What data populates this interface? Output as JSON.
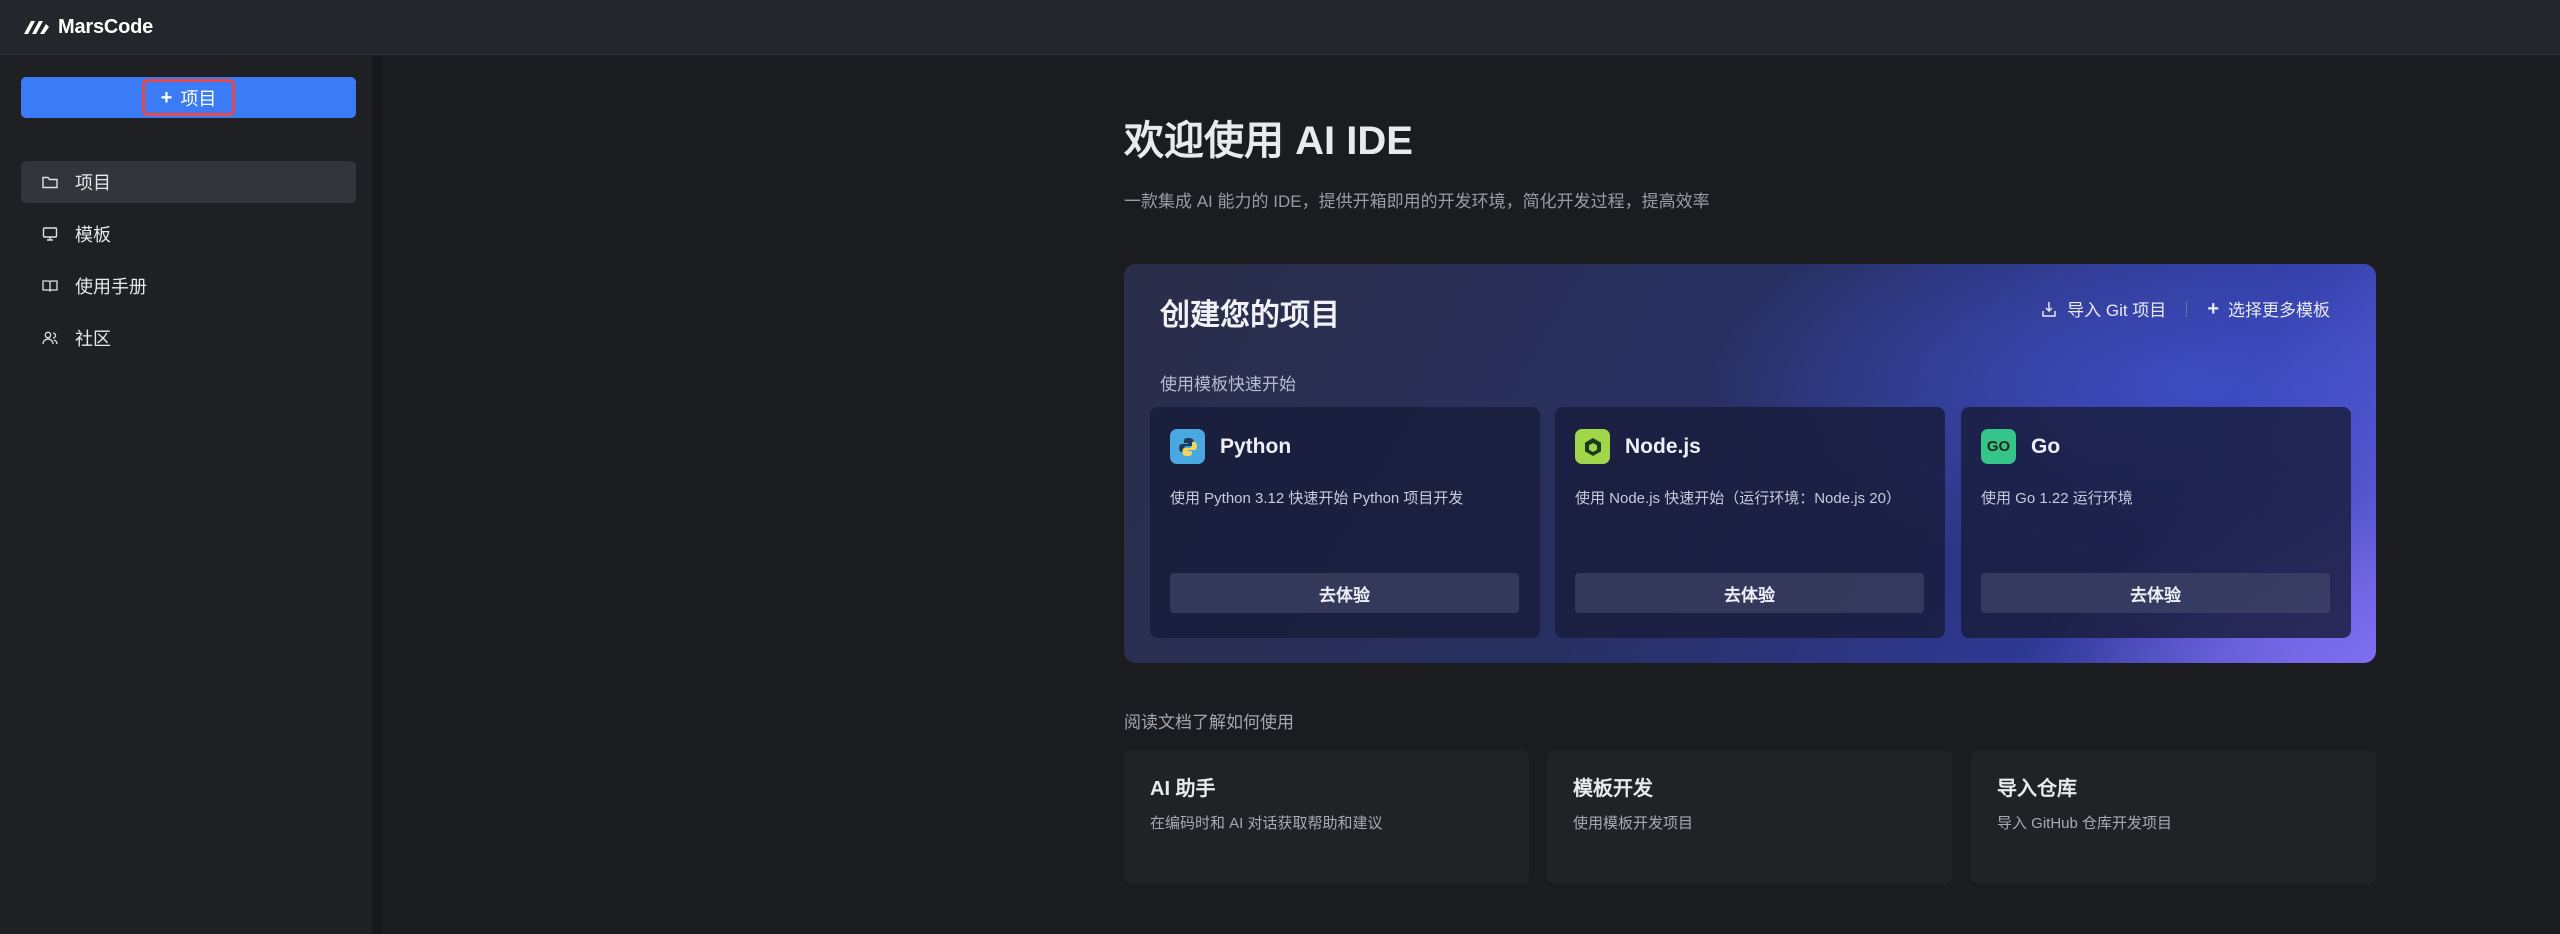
{
  "app": {
    "name": "MarsCode",
    "logo_icon": "marscode-logo-icon"
  },
  "sidebar": {
    "new_button": {
      "label": "项目",
      "icon": "plus-icon"
    },
    "items": [
      {
        "label": "项目",
        "icon": "folder-icon",
        "active": true
      },
      {
        "label": "模板",
        "icon": "monitor-icon",
        "active": false
      },
      {
        "label": "使用手册",
        "icon": "book-icon",
        "active": false
      },
      {
        "label": "社区",
        "icon": "users-icon",
        "active": false
      }
    ]
  },
  "main": {
    "title": "欢迎使用 AI IDE",
    "subtitle": "一款集成 AI 能力的 IDE，提供开箱即用的开发环境，简化开发过程，提高效率",
    "create": {
      "title": "创建您的项目",
      "import_git": "导入 Git 项目",
      "more_templates": "选择更多模板",
      "quick_start_label": "使用模板快速开始",
      "templates": [
        {
          "name": "Python",
          "description": "使用 Python 3.12 快速开始 Python 项目开发",
          "button": "去体验",
          "icon": "python-icon",
          "icon_color": "#4aa8e0"
        },
        {
          "name": "Node.js",
          "description": "使用 Node.js 快速开始（运行环境：Node.js 20）",
          "button": "去体验",
          "icon": "nodejs-icon",
          "icon_color": "#9fd64a"
        },
        {
          "name": "Go",
          "description": "使用 Go 1.22 运行环境",
          "button": "去体验",
          "icon": "go-icon",
          "icon_text": "GO",
          "icon_color": "#35c48a"
        }
      ]
    },
    "docs": {
      "label": "阅读文档了解如何使用",
      "cards": [
        {
          "title": "AI 助手",
          "description": "在编码时和 AI 对话获取帮助和建议"
        },
        {
          "title": "模板开发",
          "description": "使用模板开发项目"
        },
        {
          "title": "导入仓库",
          "description": "导入 GitHub 仓库开发项目"
        }
      ]
    }
  },
  "colors": {
    "accent": "#3b7bf6",
    "highlight_border": "#e5484d"
  }
}
